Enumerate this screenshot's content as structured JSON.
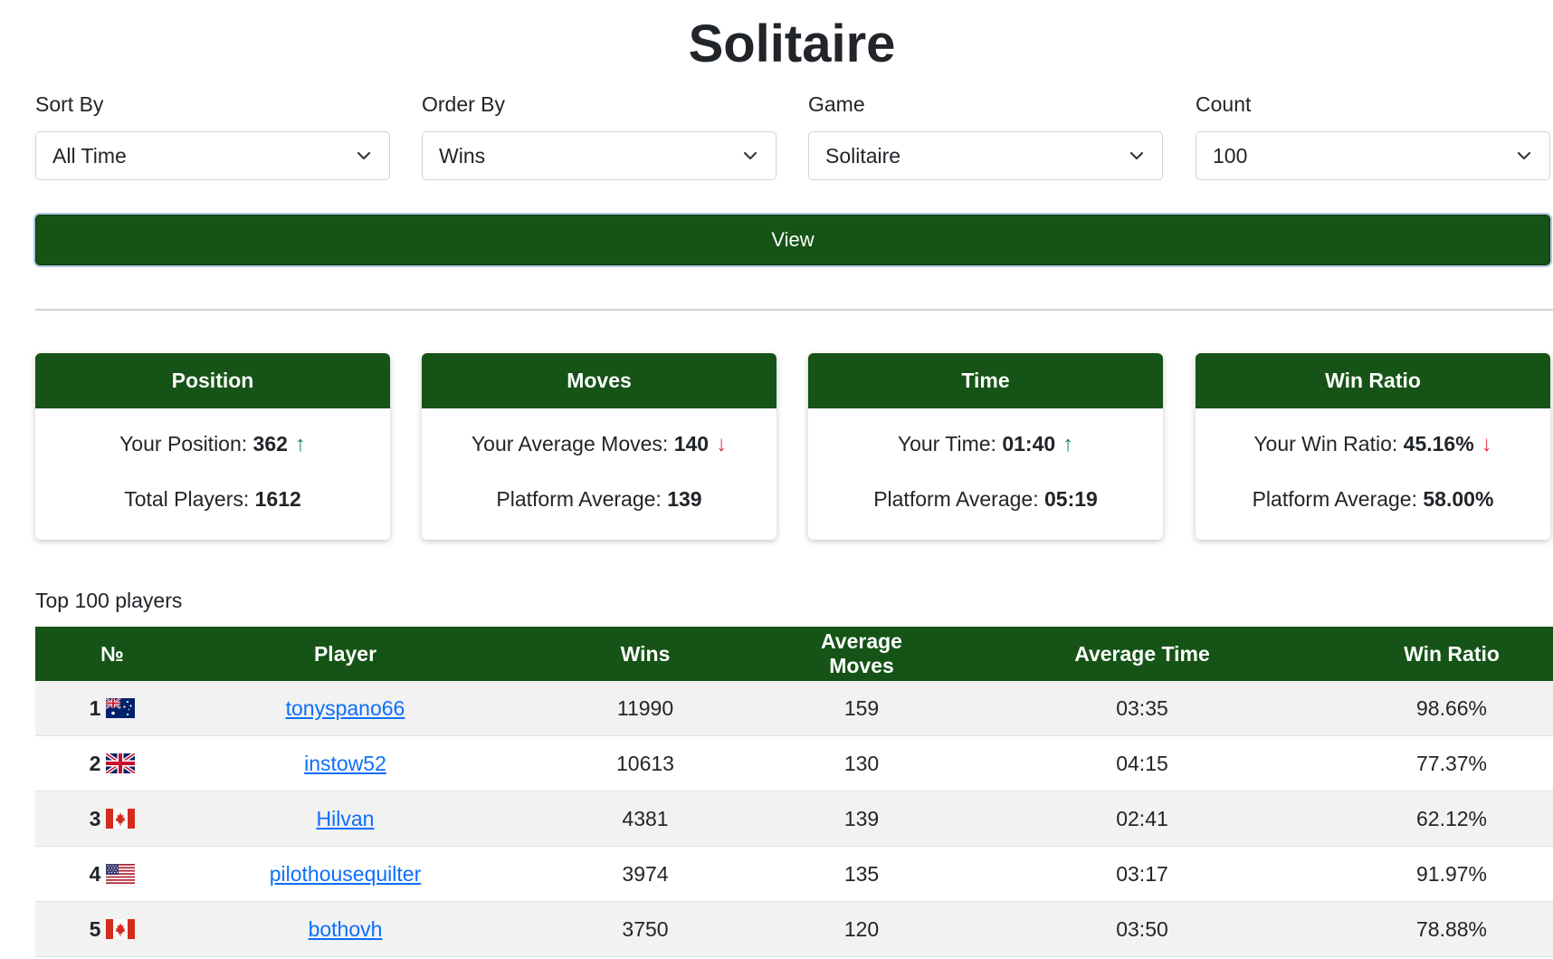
{
  "page_title": "Solitaire",
  "filters": [
    {
      "label": "Sort By",
      "value": "All Time",
      "name": "sort-by"
    },
    {
      "label": "Order By",
      "value": "Wins",
      "name": "order-by"
    },
    {
      "label": "Game",
      "value": "Solitaire",
      "name": "game"
    },
    {
      "label": "Count",
      "value": "100",
      "name": "count"
    }
  ],
  "view_button": "View",
  "cards": [
    {
      "title": "Position",
      "line1_label": "Your Position: ",
      "line1_value": "362",
      "line1_trend": "up",
      "line2_label": "Total Players: ",
      "line2_value": "1612"
    },
    {
      "title": "Moves",
      "line1_label": "Your Average Moves: ",
      "line1_value": "140",
      "line1_trend": "down",
      "line2_label": "Platform Average: ",
      "line2_value": "139"
    },
    {
      "title": "Time",
      "line1_label": "Your Time: ",
      "line1_value": "01:40",
      "line1_trend": "up",
      "line2_label": "Platform Average: ",
      "line2_value": "05:19"
    },
    {
      "title": "Win Ratio",
      "line1_label": "Your Win Ratio: ",
      "line1_value": "45.16%",
      "line1_trend": "down",
      "line2_label": "Platform Average: ",
      "line2_value": "58.00%"
    }
  ],
  "table_caption": "Top 100 players",
  "table": {
    "headers": [
      "№",
      "Player",
      "Wins",
      "Average Moves",
      "Average Time",
      "Win Ratio"
    ],
    "rows": [
      {
        "rank": "1",
        "flag": "au",
        "player": "tonyspano66",
        "wins": "11990",
        "avg_moves": "159",
        "avg_time": "03:35",
        "win_ratio": "98.66%"
      },
      {
        "rank": "2",
        "flag": "gb",
        "player": "instow52",
        "wins": "10613",
        "avg_moves": "130",
        "avg_time": "04:15",
        "win_ratio": "77.37%"
      },
      {
        "rank": "3",
        "flag": "ca",
        "player": "Hilvan",
        "wins": "4381",
        "avg_moves": "139",
        "avg_time": "02:41",
        "win_ratio": "62.12%"
      },
      {
        "rank": "4",
        "flag": "us",
        "player": "pilothousequilter",
        "wins": "3974",
        "avg_moves": "135",
        "avg_time": "03:17",
        "win_ratio": "91.97%"
      },
      {
        "rank": "5",
        "flag": "ca",
        "player": "bothovh",
        "wins": "3750",
        "avg_moves": "120",
        "avg_time": "03:50",
        "win_ratio": "78.88%"
      }
    ]
  },
  "colors": {
    "brand_green": "#155316",
    "link_blue": "#0d6efd",
    "trend_up": "#198754",
    "trend_down": "#dc3545"
  }
}
